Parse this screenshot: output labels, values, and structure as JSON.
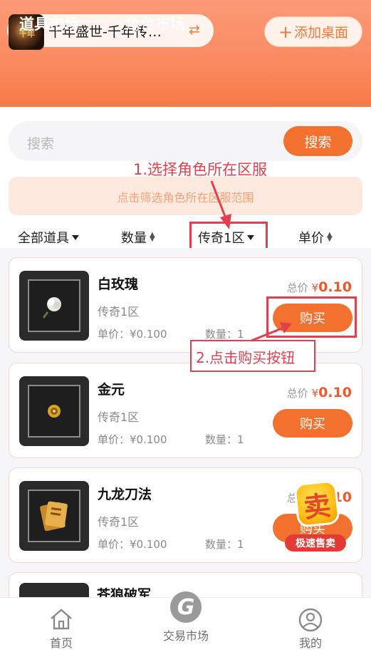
{
  "header": {
    "game_title": "千年盛世-千年传…",
    "add_desktop_label": "添加桌面"
  },
  "tabs": [
    {
      "label": "道具市场",
      "active": true
    },
    {
      "label": "角色市场",
      "active": false
    }
  ],
  "search": {
    "placeholder": "搜索",
    "button_label": "搜索"
  },
  "filter_hint": "点击筛选角色所在区服范围",
  "annotations": {
    "step1": "1.选择角色所在区服",
    "step2": "2.点击购买按钮"
  },
  "sortbar": {
    "all_items": "全部道具",
    "quantity": "数量",
    "server": "传奇1区",
    "unit_price": "单价"
  },
  "items": [
    {
      "name": "白玫瑰",
      "server": "传奇1区",
      "unit_price": "单价：¥0.100",
      "quantity": "数量：1",
      "total_label": "总价",
      "currency": "¥",
      "total": "0.10",
      "buy_label": "购买",
      "icon": "white-rose-icon"
    },
    {
      "name": "金元",
      "server": "传奇1区",
      "unit_price": "单价：¥0.100",
      "quantity": "数量：1",
      "total_label": "总价",
      "currency": "¥",
      "total": "0.10",
      "buy_label": "购买",
      "icon": "gold-coin-icon"
    },
    {
      "name": "九龙刀法",
      "server": "传奇1区",
      "unit_price": "单价：¥0.100",
      "quantity": "数量：1",
      "total_label": "总价",
      "currency": "¥",
      "total": "0.10",
      "buy_label": "购买",
      "icon": "skill-book-icon"
    },
    {
      "name": "苍狼破军"
    }
  ],
  "sell_badge": {
    "char": "卖",
    "label": "极速售卖"
  },
  "bottom_nav": [
    {
      "label": "首页",
      "icon": "home-icon"
    },
    {
      "label": "交易市场",
      "icon": "g-logo-icon"
    },
    {
      "label": "我的",
      "icon": "user-icon"
    }
  ],
  "colors": {
    "accent": "#f2712f",
    "annotation": "#e3404f",
    "price": "#f0582a"
  }
}
